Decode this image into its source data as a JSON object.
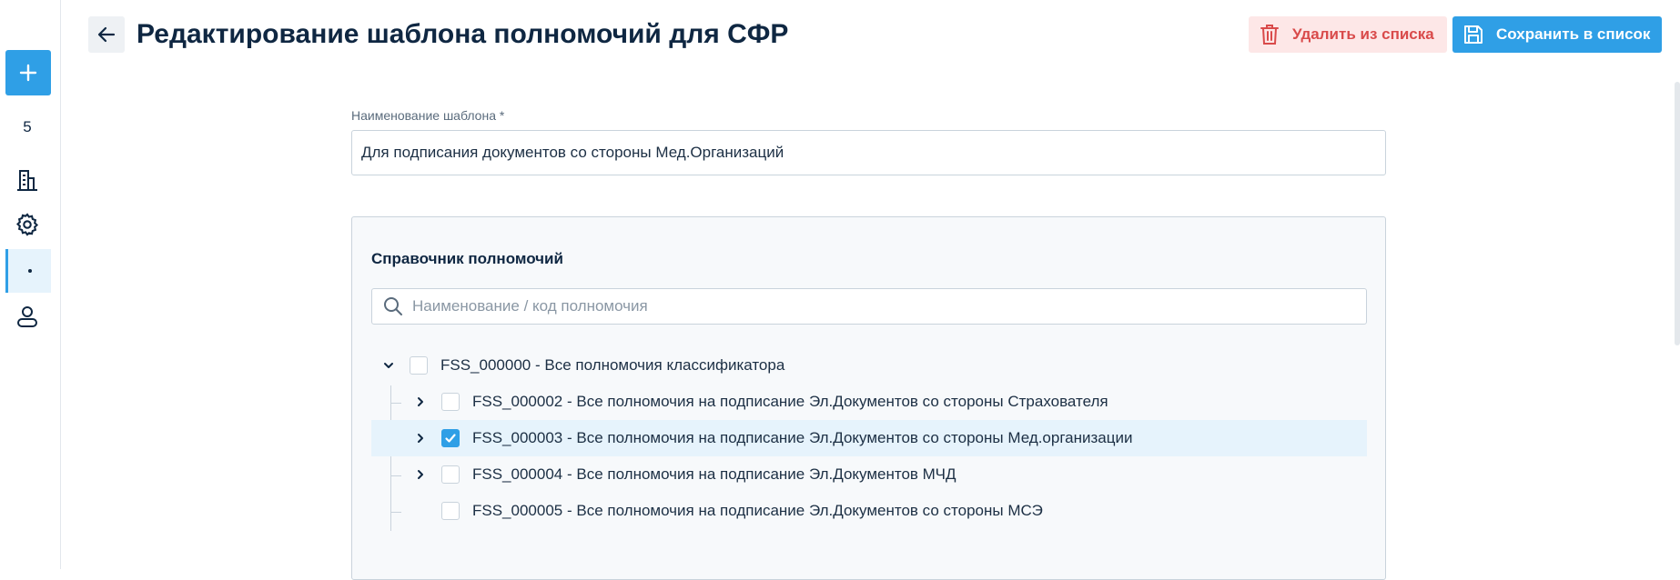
{
  "header": {
    "title": "Редактирование шаблона полномочий для СФР",
    "delete_label": "Удалить из списка",
    "save_label": "Сохранить в список"
  },
  "sidebar": {
    "count": "5",
    "items": [
      {
        "icon": "plus-icon"
      },
      {
        "icon": "building-icon"
      },
      {
        "icon": "gear-icon"
      },
      {
        "icon": "dot-icon",
        "active": true
      },
      {
        "icon": "user-icon"
      }
    ]
  },
  "form": {
    "name_label": "Наименование шаблона *",
    "name_value": "Для подписания документов со стороны Мед.Организаций"
  },
  "catalog": {
    "title": "Справочник полномочий",
    "search_placeholder": "Наименование / код полномочия",
    "tree": [
      {
        "label": "FSS_000000 - Все полномочия классификатора",
        "level": 0,
        "expanded": true,
        "checked": false
      },
      {
        "label": "FSS_000002 - Все полномочия на подписание Эл.Документов со стороны Страхователя",
        "level": 1,
        "expandable": true,
        "checked": false
      },
      {
        "label": "FSS_000003 - Все полномочия на подписание Эл.Документов со стороны Мед.организации",
        "level": 1,
        "expandable": true,
        "checked": true
      },
      {
        "label": "FSS_000004 - Все полномочия на подписание Эл.Документов МЧД",
        "level": 1,
        "expandable": true,
        "checked": false
      },
      {
        "label": "FSS_000005 - Все полномочия на подписание Эл.Документов со стороны МСЭ",
        "level": 1,
        "expandable": false,
        "checked": false
      }
    ]
  },
  "colors": {
    "accent": "#2f9fe6",
    "danger": "#d94a4a",
    "danger_bg": "#fde7e7",
    "title": "#0f2742",
    "selected_row": "#e6f3fc"
  }
}
